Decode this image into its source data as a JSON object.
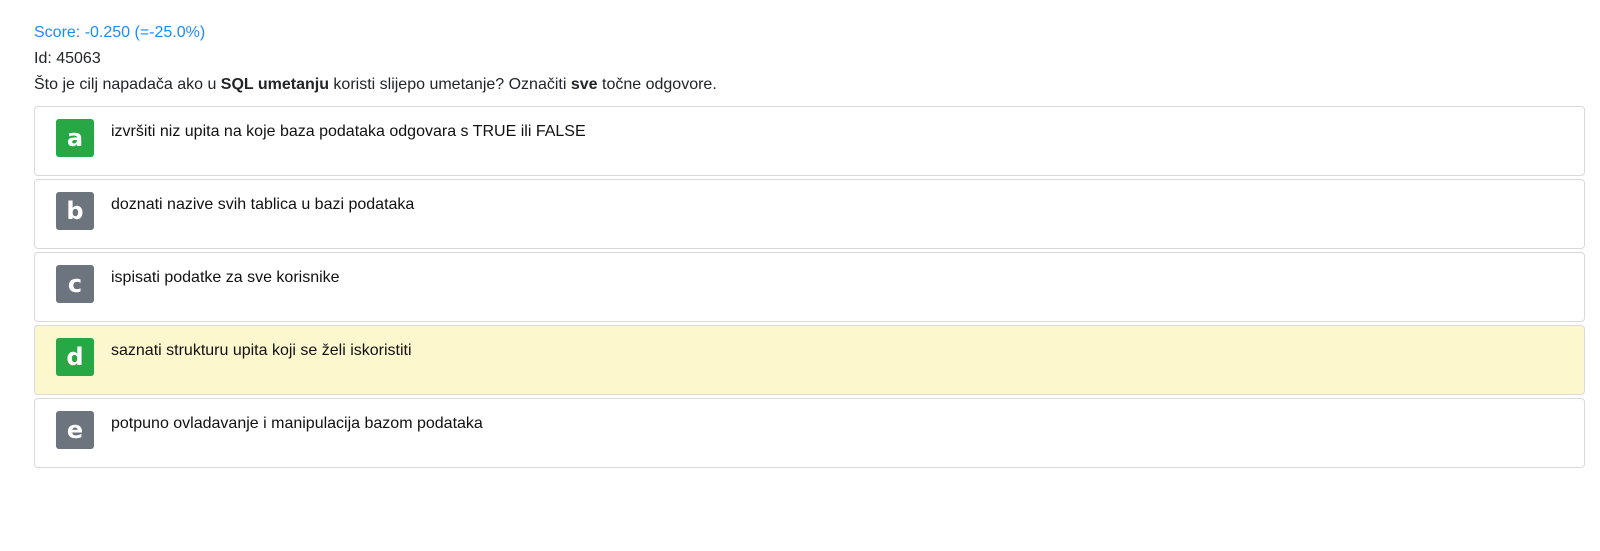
{
  "score_text": "Score: -0.250 (=-25.0%)",
  "id_text": "Id: 45063",
  "question": {
    "part1": "Što je cilj napadača ako u ",
    "bold1": "SQL umetanju",
    "part2": " koristi slijepo umetanje? Označiti ",
    "bold2": "sve",
    "part3": " točne odgovore."
  },
  "answers": [
    {
      "letter": "a",
      "text": "izvršiti niz upita na koje baza podataka odgovara s TRUE ili FALSE",
      "correct": true,
      "selected": false
    },
    {
      "letter": "b",
      "text": "doznati nazive svih tablica u bazi podataka",
      "correct": false,
      "selected": false
    },
    {
      "letter": "c",
      "text": "ispisati podatke za sve korisnike",
      "correct": false,
      "selected": false
    },
    {
      "letter": "d",
      "text": "saznati strukturu upita koji se želi iskoristiti",
      "correct": true,
      "selected": true
    },
    {
      "letter": "e",
      "text": "potpuno ovladavanje i manipulacija bazom podataka",
      "correct": false,
      "selected": false
    }
  ],
  "colors": {
    "score": "#1a8cff",
    "correct_badge": "#28a745",
    "neutral_badge": "#6c757d",
    "selected_background": "#fdf7cd"
  }
}
